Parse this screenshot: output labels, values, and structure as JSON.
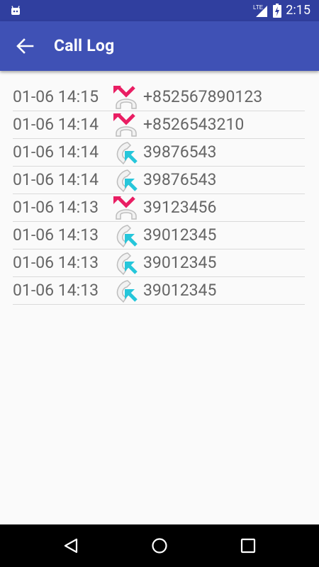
{
  "status_bar": {
    "network": "LTE",
    "time": "2:15"
  },
  "app_bar": {
    "title": "Call Log",
    "back_icon": "arrow-left-icon"
  },
  "calls": [
    {
      "time": "01-06 14:15",
      "type": "incoming-missed-icon",
      "number": "+852567890123"
    },
    {
      "time": "01-06 14:14",
      "type": "incoming-missed-icon",
      "number": "+8526543210"
    },
    {
      "time": "01-06 14:14",
      "type": "outgoing-call-icon",
      "number": "39876543"
    },
    {
      "time": "01-06 14:14",
      "type": "outgoing-call-icon",
      "number": "39876543"
    },
    {
      "time": "01-06 14:13",
      "type": "incoming-missed-icon",
      "number": "39123456"
    },
    {
      "time": "01-06 14:13",
      "type": "outgoing-call-icon",
      "number": "39012345"
    },
    {
      "time": "01-06 14:13",
      "type": "outgoing-call-icon",
      "number": "39012345"
    },
    {
      "time": "01-06 14:13",
      "type": "outgoing-call-icon",
      "number": "39012345"
    }
  ],
  "colors": {
    "status_bar": "#303f9f",
    "app_bar": "#3f51b5",
    "missed_arrow": "#e91e63",
    "outgoing_arrow": "#26c6da"
  }
}
